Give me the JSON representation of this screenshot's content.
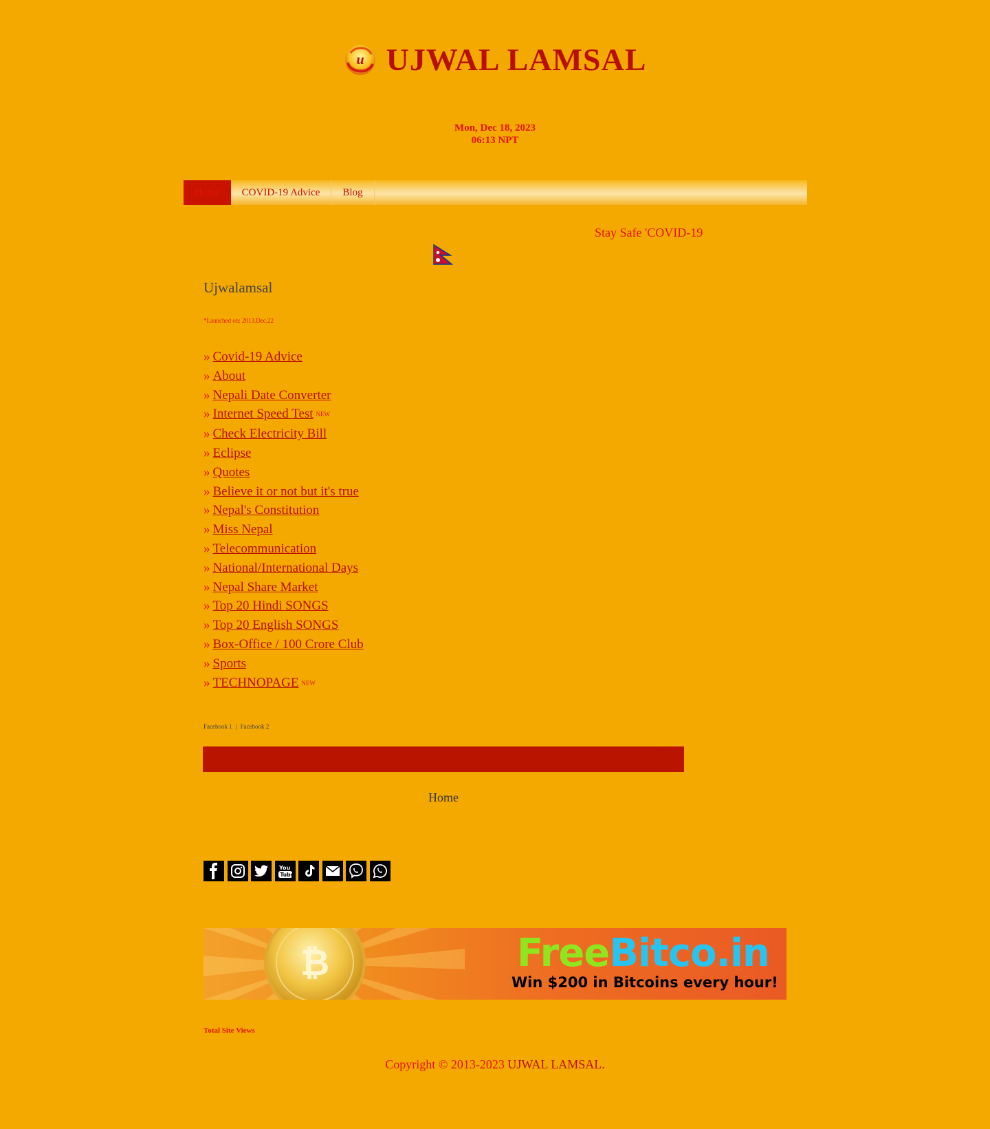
{
  "header": {
    "logo_letter": "u",
    "title": "UJWAL LAMSAL"
  },
  "datetime": {
    "date": "Mon, Dec 18, 2023",
    "time": "06:13 NPT"
  },
  "nav": {
    "items": [
      {
        "label": "Home",
        "active": true
      },
      {
        "label": "COVID-19 Advice",
        "active": false
      },
      {
        "label": "Blog",
        "active": false
      }
    ]
  },
  "marquee": "Stay Safe 'COVID-19",
  "main": {
    "site_name": "Ujwalamsal",
    "launched": "*Launched on: 2013.Dec.22",
    "bullet": "»",
    "new_badge": "NEW",
    "links": [
      {
        "label": "Covid-19 Advice"
      },
      {
        "label": "About"
      },
      {
        "label": "Nepali Date Converter"
      },
      {
        "label": "Internet Speed Test",
        "new": true
      },
      {
        "label": "Check Electricity Bill"
      },
      {
        "label": "Eclipse"
      },
      {
        "label": "Quotes"
      },
      {
        "label": "Believe it or not but it's true"
      },
      {
        "label": "Nepal's Constitution"
      },
      {
        "label": "Miss Nepal"
      },
      {
        "label": "Telecommunication"
      },
      {
        "label": "National/International Days"
      },
      {
        "label": "Nepal Share Market"
      },
      {
        "label": "Top 20 Hindi SONGS"
      },
      {
        "label": "Top 20 English SONGS"
      },
      {
        "label": "Box-Office / 100 Crore Club"
      },
      {
        "label": "Sports"
      },
      {
        "label": "TECHNOPAGE",
        "new": true
      }
    ]
  },
  "facebook": {
    "link1": "Facebook 1",
    "separator": "|",
    "link2": "Facebook 2"
  },
  "footer_home": "Home",
  "social": [
    "facebook-icon",
    "instagram-icon",
    "twitter-icon",
    "youtube-icon",
    "tiktok-icon",
    "email-icon",
    "viber-icon",
    "whatsapp-icon"
  ],
  "banner": {
    "brand_free": "Free",
    "brand_rest": "Bitco.in",
    "tagline": "Win $200 in Bitcoins every hour!"
  },
  "total_views": "Total Site Views",
  "copyright": {
    "prefix": "Copyright © 2013-2023",
    "name": "UJWAL LAMSAL."
  },
  "colors": {
    "background": "#f4a900",
    "accent_red": "#e0150a",
    "dark_red": "#b81000"
  }
}
